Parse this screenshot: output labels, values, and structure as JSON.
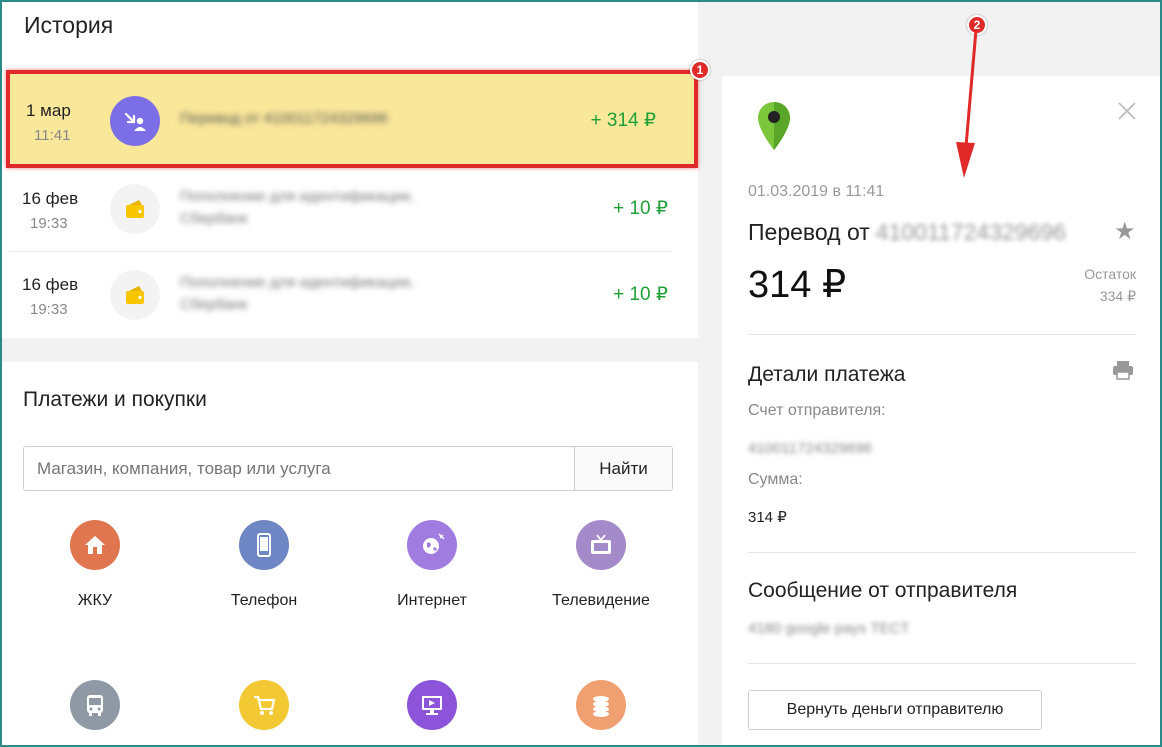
{
  "history": {
    "title": "История",
    "transactions": [
      {
        "date": "1 мар",
        "time": "11:41",
        "description": "Перевод от 410011724329696",
        "amount": "+ 314 ₽",
        "icon": "incoming-transfer-icon"
      },
      {
        "date": "16 фев",
        "time": "19:33",
        "description": "Пополнение для идентификации, Сбербанк",
        "amount": "+ 10 ₽",
        "icon": "wallet-icon"
      },
      {
        "date": "16 фев",
        "time": "19:33",
        "description": "Пополнение для идентификации, Сбербанк",
        "amount": "+ 10 ₽",
        "icon": "wallet-icon"
      }
    ]
  },
  "annotations": {
    "badge_1": "1",
    "badge_2": "2"
  },
  "payments": {
    "title": "Платежи и покупки",
    "search_placeholder": "Магазин, компания, товар или услуга",
    "search_button": "Найти",
    "categories": [
      {
        "label": "ЖКУ",
        "icon": "home-icon",
        "color": "#e07650"
      },
      {
        "label": "Телефон",
        "icon": "phone-icon",
        "color": "#6f86c4"
      },
      {
        "label": "Интернет",
        "icon": "globe-icon",
        "color": "#a07be0"
      },
      {
        "label": "Телевидение",
        "icon": "tv-icon",
        "color": "#a48ac8"
      },
      {
        "label": "",
        "icon": "bus-icon",
        "color": "#8f99a6"
      },
      {
        "label": "",
        "icon": "cart-icon",
        "color": "#f2c833"
      },
      {
        "label": "",
        "icon": "monitor-icon",
        "color": "#8c54d8"
      },
      {
        "label": "",
        "icon": "coins-icon",
        "color": "#f0a070"
      }
    ]
  },
  "details": {
    "date": "01.03.2019 в 11:41",
    "title_prefix": "Перевод от",
    "title_account": "410011724329696",
    "amount": "314 ₽",
    "balance_label": "Остаток",
    "balance_value": "334 ₽",
    "section_title": "Детали платежа",
    "sender_account_label": "Счет отправителя:",
    "sender_account_value": "410011724329696",
    "sum_label": "Сумма:",
    "sum_value": "314 ₽",
    "message_title": "Сообщение от отправителя",
    "message_text": "4180 google pays TECT",
    "refund_button": "Вернуть деньги отправителю"
  },
  "colors": {
    "income": "#21a038",
    "highlight_fill": "#f9e79a",
    "highlight_border": "#e02a2a",
    "transfer_icon_bg": "#7b6ee6"
  }
}
